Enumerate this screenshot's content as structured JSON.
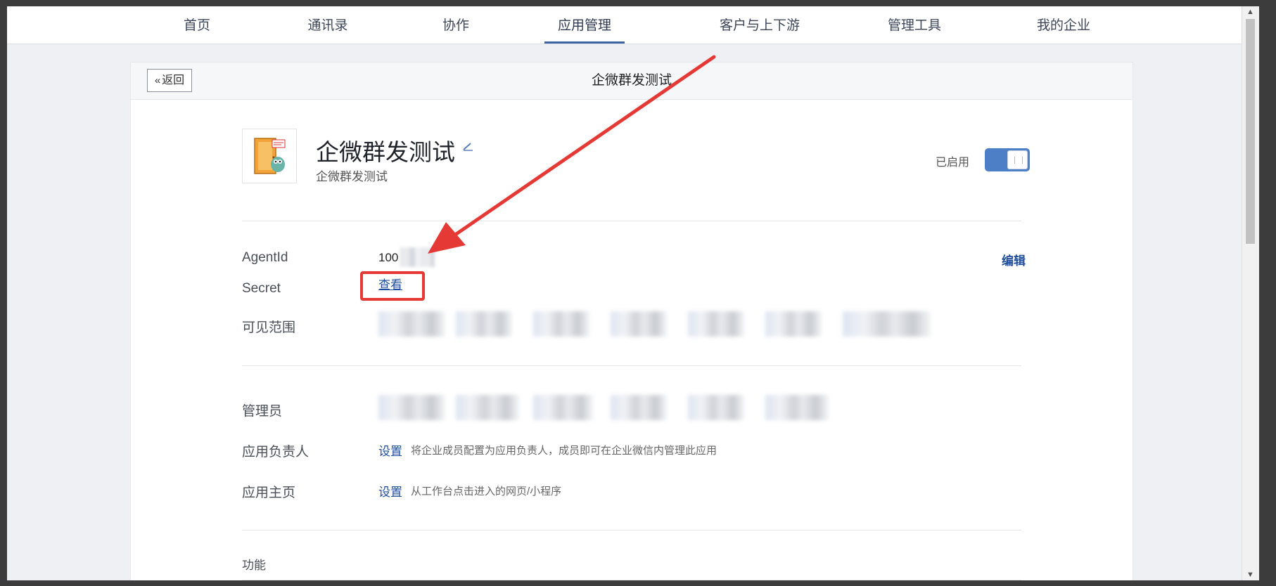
{
  "nav": {
    "items": [
      "首页",
      "通讯录",
      "协作",
      "应用管理",
      "客户与上下游",
      "管理工具",
      "我的企业"
    ],
    "active_index": 3
  },
  "card": {
    "back_label": "返回",
    "title": "企微群发测试"
  },
  "app": {
    "name": "企微群发测试",
    "description": "企微群发测试",
    "status_label": "已启用",
    "enabled": true
  },
  "fields": {
    "agentid_label": "AgentId",
    "agentid_value": "100",
    "edit_label": "编辑",
    "secret_label": "Secret",
    "secret_view": "查看",
    "visible_range_label": "可见范围",
    "admin_label": "管理员",
    "owner_label": "应用负责人",
    "owner_action": "设置",
    "owner_hint": "将企业成员配置为应用负责人，成员即可在企业微信内管理此应用",
    "homepage_label": "应用主页",
    "homepage_action": "设置",
    "homepage_hint": "从工作台点击进入的网页/小程序",
    "features_label": "功能"
  },
  "colors": {
    "accent": "#3e64a4",
    "toggle_on": "#4d7fc6",
    "annotation_red": "#e53935",
    "link": "#1e4e9e"
  }
}
